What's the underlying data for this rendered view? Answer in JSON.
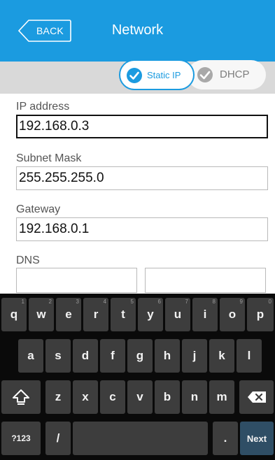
{
  "header": {
    "back_label": "BACK",
    "title": "Network",
    "bg_color": "#1b9be0"
  },
  "mode": {
    "static_label": "Static IP",
    "dhcp_label": "DHCP",
    "selected": "Static IP",
    "static_icon": "check-circle-icon",
    "dhcp_icon": "check-circle-icon"
  },
  "form": {
    "ip": {
      "label": "IP address",
      "value": "192.168.0.3"
    },
    "subnet": {
      "label": "Subnet Mask",
      "value": "255.255.255.0"
    },
    "gateway": {
      "label": "Gateway",
      "value": "192.168.0.1"
    },
    "dns": {
      "label": "DNS",
      "primary": "",
      "secondary": ""
    }
  },
  "keyboard": {
    "row1": [
      {
        "k": "q",
        "h": "1"
      },
      {
        "k": "w",
        "h": "2"
      },
      {
        "k": "e",
        "h": "3"
      },
      {
        "k": "r",
        "h": "4"
      },
      {
        "k": "t",
        "h": "5"
      },
      {
        "k": "y",
        "h": "6"
      },
      {
        "k": "u",
        "h": "7"
      },
      {
        "k": "i",
        "h": "8"
      },
      {
        "k": "o",
        "h": "9"
      },
      {
        "k": "p",
        "h": "0"
      }
    ],
    "row2": [
      "a",
      "s",
      "d",
      "f",
      "g",
      "h",
      "j",
      "k",
      "l"
    ],
    "row3": [
      "z",
      "x",
      "c",
      "v",
      "b",
      "n",
      "m"
    ],
    "shift_icon": "shift-icon",
    "backspace_icon": "backspace-icon",
    "symbols_label": "?123",
    "slash_label": "/",
    "period_label": ".",
    "next_label": "Next"
  }
}
